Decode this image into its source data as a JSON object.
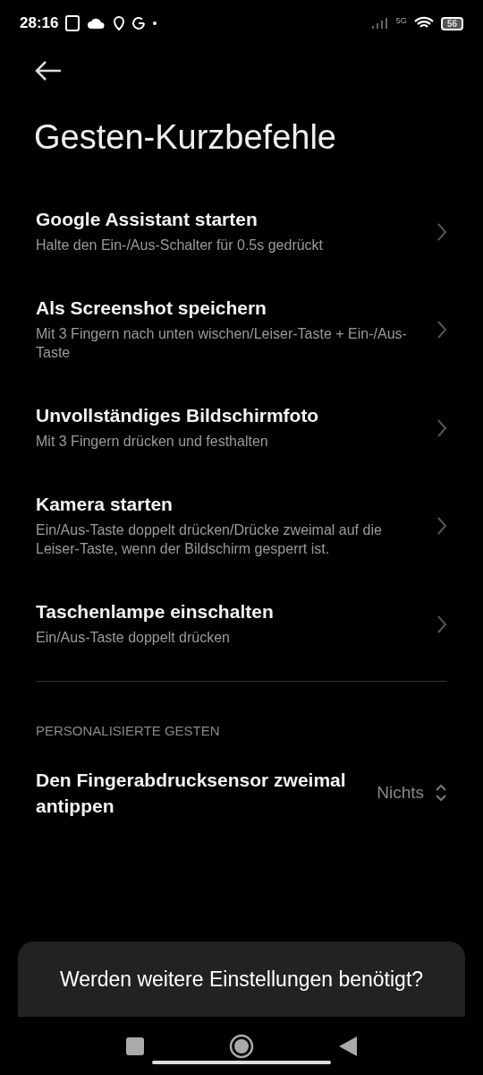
{
  "status_bar": {
    "time": "28:16",
    "network": "5G",
    "battery": "56"
  },
  "title": "Gesten-Kurzbefehle",
  "items": [
    {
      "title": "Google Assistant starten",
      "subtitle": "Halte den Ein-/Aus-Schalter für 0.5s gedrückt"
    },
    {
      "title": "Als Screenshot speichern",
      "subtitle": "Mit 3 Fingern nach unten wischen/Leiser-Taste + Ein-/Aus-Taste"
    },
    {
      "title": "Unvollständiges Bildschirmfoto",
      "subtitle": "Mit 3 Fingern drücken und festhalten"
    },
    {
      "title": "Kamera starten",
      "subtitle": "Ein/Aus-Taste doppelt drücken/Drücke zweimal auf die Leiser-Taste, wenn der Bildschirm gesperrt ist."
    },
    {
      "title": "Taschenlampe einschalten",
      "subtitle": "Ein/Aus-Taste doppelt drücken"
    }
  ],
  "section": {
    "header": "PERSONALISIERTE GESTEN",
    "items": [
      {
        "title": "Den Fingerabdrucksensor zweimal antippen",
        "value": "Nichts"
      }
    ]
  },
  "sheet": {
    "question": "Werden weitere Einstellungen benötigt?"
  }
}
